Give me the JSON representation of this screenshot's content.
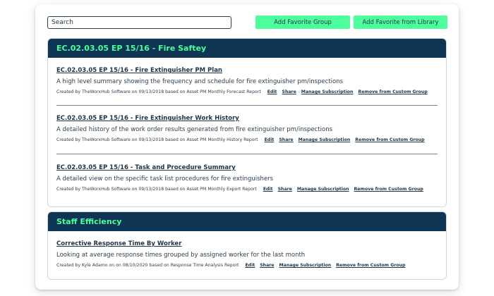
{
  "search": {
    "placeholder": "Search"
  },
  "toolbar": {
    "add_group_label": "Add Favorite Group",
    "add_library_label": "Add Favorite from Library"
  },
  "groups": [
    {
      "title": "EC.02.03.05 EP 15/16 - Fire Saftey",
      "items": [
        {
          "title": "EC.02.03.05 EP 15/16 - Fire Extinguisher PM Plan",
          "description": "A high level summary showing the frequency and schedule for fire extinguisher pm/inspections",
          "meta": "Created by TheWorxHub Software on 09/13/2018 based on Asset PM Monthly Forecast Report",
          "actions": [
            "Edit",
            "Share",
            "Manage Subscription",
            "Remove from Custom Group"
          ]
        },
        {
          "title": "EC.02.03.05 EP 15/16 - Fire Extinguisher Work History",
          "description": "A detailed history of the work order results generated from fire extinguisher pm/inspections",
          "meta": "Created by TheWorxHub Software on 09/13/2018 based on Asset PM Monthly History Report",
          "actions": [
            "Edit",
            "Share",
            "Manage Subscription",
            "Remove from Custom Group"
          ]
        },
        {
          "title": "EC.02.03.05 EP 15/16 - Task and Procedure Summary",
          "description": "A detailed view on the specific task list procedures for fire extinguishers",
          "meta": "Created by TheWorxHub Software on 09/13/2018 based on Asset PM Monthly Export Report",
          "actions": [
            "Edit",
            "Share",
            "Manage Subscription",
            "Remove from Custom Group"
          ]
        }
      ]
    },
    {
      "title": "Staff Efficiency",
      "items": [
        {
          "title": "Corrective Response Time By Worker",
          "description": "Looking at average response times grouped by assigned worker for the last month",
          "meta": "Created by Kyle Adamo on on 08/10/2020 based on Response Time Analysis Report",
          "actions": [
            "Edit",
            "Share",
            "Manage Subscription",
            "Remove from Custom Group"
          ]
        }
      ]
    }
  ]
}
